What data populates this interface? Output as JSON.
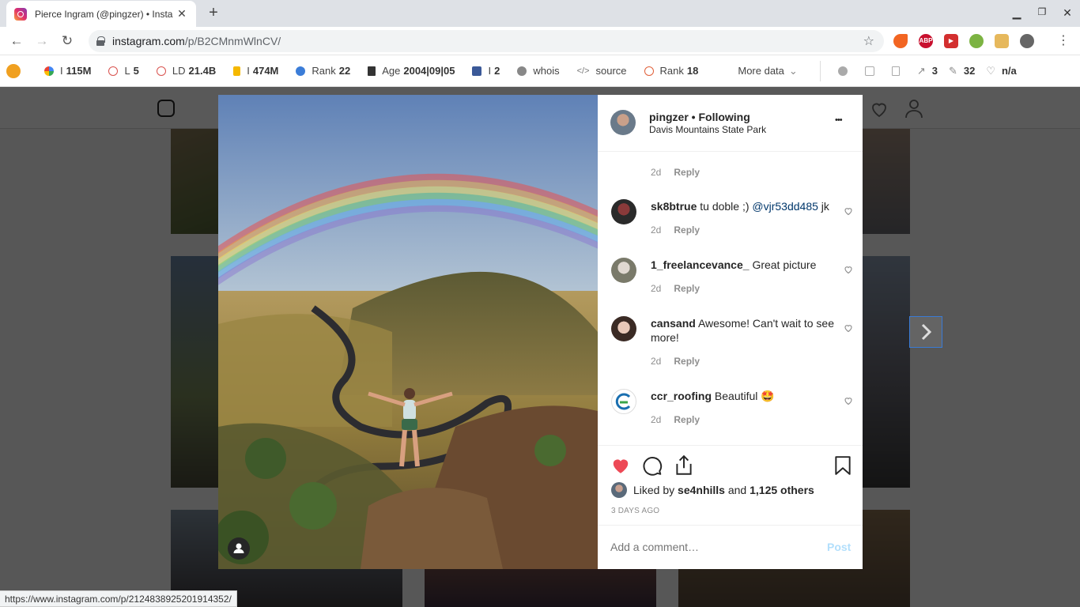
{
  "browser": {
    "tab_title": "Pierce Ingram (@pingzer) • Insta",
    "tab_close": "✕",
    "new_tab": "+",
    "url_host": "instagram.com",
    "url_path": "/p/B2CMnmWlnCV/",
    "status_url": "https://www.instagram.com/p/2124838925201914352/"
  },
  "seobar": {
    "items": [
      {
        "label": "I",
        "value": "115M"
      },
      {
        "label": "L",
        "value": "5"
      },
      {
        "label": "LD",
        "value": "21.4B"
      },
      {
        "label": "I",
        "value": "474M"
      },
      {
        "label": "Rank",
        "value": "22"
      },
      {
        "label": "Age",
        "value": "2004|09|05"
      },
      {
        "label": "I",
        "value": "2"
      },
      {
        "label": "whois",
        "value": ""
      },
      {
        "label": "source",
        "value": ""
      },
      {
        "label": "Rank",
        "value": "18"
      }
    ],
    "more_data": "More data",
    "right_links": "3",
    "right_count": "32",
    "right_na": "n/a"
  },
  "post": {
    "username": "pingzer",
    "follow_status": "• Following",
    "location": "Davis Mountains State Park",
    "more": "•••",
    "first_time": "2d",
    "first_reply": "Reply",
    "comments": [
      {
        "user": "sk8btrue",
        "text": "tu doble ;) ",
        "mention": "@vjr53dd485",
        "tail": " jk",
        "time": "2d",
        "reply": "Reply"
      },
      {
        "user": "1_freelancevance_",
        "text": "Great picture",
        "time": "2d",
        "reply": "Reply"
      },
      {
        "user": "cansand",
        "text": "Awesome! Can't wait to see more!",
        "time": "2d",
        "reply": "Reply"
      },
      {
        "user": "ccr_roofing",
        "text": "Beautiful 🤩",
        "time": "2d",
        "reply": "Reply"
      }
    ],
    "liked_by_prefix": "Liked by",
    "liked_by_user": "se4nhills",
    "liked_by_and": "and",
    "liked_by_others": "1,125 others",
    "posted_ago": "3 DAYS AGO",
    "comment_placeholder": "Add a comment…",
    "post_button": "Post"
  },
  "colors": {
    "like_red": "#ed4956",
    "link_blue": "#00376b",
    "post_disabled": "#b2dffc"
  }
}
